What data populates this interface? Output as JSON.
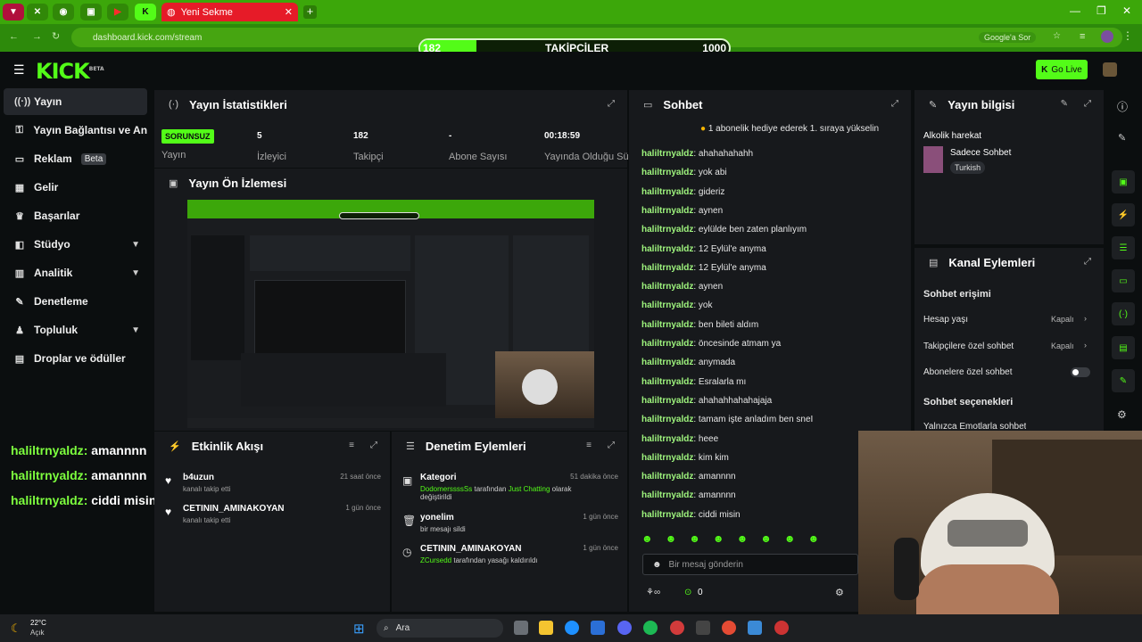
{
  "browser": {
    "tab_title": "Yeni Sekme",
    "url": "dashboard.kick.com/stream",
    "google_search_label": "Google'a Sor"
  },
  "follower_goal": {
    "label": "TAKİPÇİLER",
    "current": "182",
    "target": "1000",
    "progress": 0.182
  },
  "header": {
    "logo": "KICK",
    "logo_badge": "BETA",
    "go_live_label": "Go Live"
  },
  "sidebar": {
    "items": [
      {
        "label": "Yayın",
        "active": true
      },
      {
        "label": "Yayın Bağlantısı ve Anahtarı"
      },
      {
        "label": "Reklam",
        "badge": "Beta"
      },
      {
        "label": "Gelir"
      },
      {
        "label": "Başarılar"
      },
      {
        "label": "Stüdyo",
        "expandable": true
      },
      {
        "label": "Analitik",
        "expandable": true
      },
      {
        "label": "Denetleme"
      },
      {
        "label": "Topluluk",
        "expandable": true
      },
      {
        "label": "Droplar ve ödüller"
      }
    ]
  },
  "stats": {
    "title": "Yayın İstatistikleri",
    "status_badge": "SORUNSUZ",
    "status_label": "Yayın",
    "viewers_value": "5",
    "viewers_label": "İzleyici",
    "followers_value": "182",
    "followers_label": "Takipçi",
    "subs_value": "-",
    "subs_label": "Abone Sayısı",
    "uptime_value": "00:18:59",
    "uptime_label": "Yayında Olduğu Süre"
  },
  "preview": {
    "title": "Yayın Ön İzlemesi"
  },
  "activity": {
    "title": "Etkinlik Akışı",
    "items": [
      {
        "name": "b4uzun",
        "sub": "kanalı takip etti",
        "time": "21 saat önce"
      },
      {
        "name": "CETININ_AMINAKOYAN",
        "sub": "kanalı takip etti",
        "time": "1 gün önce"
      }
    ]
  },
  "moderation": {
    "title": "Denetim Eylemleri",
    "items": [
      {
        "name": "Kategori",
        "sub_user": "DodomerssssSs",
        "sub_mid": " tarafından ",
        "sub_target": "Just Chatting",
        "sub_end": " olarak",
        "sub_line2": "değiştirildi",
        "time": "51 dakika önce"
      },
      {
        "name": "yonelim",
        "sub": "bir mesajı sildi",
        "time": "1 gün önce"
      },
      {
        "name": "CETININ_AMINAKOYAN",
        "sub_user": "ZCursedd",
        "sub_end": " tarafından yasağı kaldırıldı",
        "time": "1 gün önce"
      }
    ]
  },
  "chat": {
    "title": "Sohbet",
    "pinned": "1 abonelik hediye ederek 1. sıraya yükselin",
    "user": "haliltrnyaldz",
    "messages": [
      "ahahahahahh",
      "yok abi",
      "gideriz",
      "aynen",
      "eylülde ben zaten planlıyım",
      "12 Eylül'e anyma",
      "12 Eylül'e anyma",
      "aynen",
      "yok",
      "ben bileti aldım",
      "öncesinde atmam ya",
      "anymada",
      "Esralarla mı",
      "ahahahhahahajaja",
      "tamam işte anladım ben sneI",
      "heee",
      "kim kim",
      "amannnn",
      "amannnn",
      "ciddi misin"
    ],
    "input_placeholder": "Bir mesaj gönderin",
    "points": "0"
  },
  "stream_info": {
    "title": "Yayın bilgisi",
    "stream_title": "Alkolik harekat",
    "category": "Sadece Sohbet",
    "language": "Turkish"
  },
  "channel_actions": {
    "title": "Kanal Eylemleri",
    "section_access": "Sohbet erişimi",
    "rows": [
      {
        "label": "Hesap yaşı",
        "value": "Kapalı"
      },
      {
        "label": "Takipçilere özel sohbet",
        "value": "Kapalı"
      },
      {
        "label": "Abonelere özel sohbet",
        "value": ""
      }
    ],
    "section_options": "Sohbet seçenekleri",
    "emote_row": "Yalnızca Emotlarla sohbet"
  },
  "overlay_chat": [
    {
      "user": "haliltrnyaldz",
      "msg": "amannnn"
    },
    {
      "user": "haliltrnyaldz",
      "msg": "amannnn"
    },
    {
      "user": "haliltrnyaldz",
      "msg": "ciddi misin"
    }
  ],
  "taskbar": {
    "weather_temp": "22°C",
    "weather_desc": "Açık",
    "search_label": "Ara"
  },
  "colors": {
    "kick_green": "#53fc18",
    "tab_green": "#3ca70a",
    "red": "#e61b28"
  }
}
